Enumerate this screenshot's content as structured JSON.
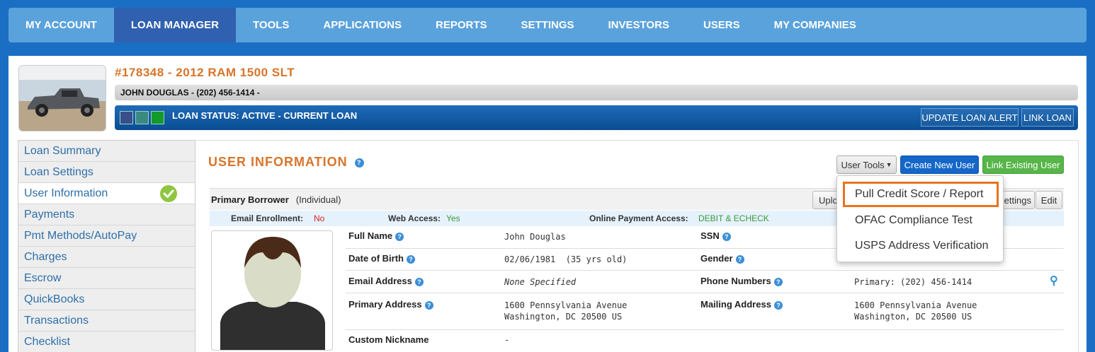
{
  "nav": {
    "items": [
      "MY ACCOUNT",
      "LOAN MANAGER",
      "TOOLS",
      "APPLICATIONS",
      "REPORTS",
      "SETTINGS",
      "INVESTORS",
      "USERS",
      "MY COMPANIES"
    ],
    "active": "LOAN MANAGER"
  },
  "loan": {
    "title": "#178348 - 2012 RAM 1500 SLT",
    "borrower_line": "JOHN DOUGLAS - (202) 456-1414 -",
    "status": "LOAN STATUS: ACTIVE - CURRENT LOAN",
    "update_alert": "UPDATE LOAN ALERT",
    "link_loan": "LINK LOAN"
  },
  "sidebar": {
    "items": [
      {
        "label": "Loan Summary"
      },
      {
        "label": "Loan Settings"
      },
      {
        "label": "User Information"
      },
      {
        "label": "Payments"
      },
      {
        "label": "Pmt Methods/AutoPay"
      },
      {
        "label": "Charges"
      },
      {
        "label": "Escrow"
      },
      {
        "label": "QuickBooks"
      },
      {
        "label": "Transactions"
      },
      {
        "label": "Checklist"
      }
    ]
  },
  "content": {
    "section_title": "USER INFORMATION",
    "user_tools": "User Tools",
    "create_user": "Create New User",
    "link_user": "Link Existing User",
    "borrower_label": "Primary Borrower",
    "borrower_type": "(Individual)",
    "upload_btn": "Uplo",
    "settings_btn": "Settings",
    "edit_btn": "Edit",
    "access": {
      "email_label": "Email Enrollment:",
      "email_value": "No",
      "web_label": "Web Access:",
      "web_value": "Yes",
      "online_label": "Online Payment Access:",
      "online_value": "DEBIT & ECHECK"
    },
    "fields": {
      "full_name_label": "Full Name",
      "full_name": "John Douglas",
      "ssn_label": "SSN",
      "dob_label": "Date of Birth",
      "dob": "02/06/1981  (35 yrs old)",
      "gender_label": "Gender",
      "email_label": "Email Address",
      "email": "None Specified",
      "phone_label": "Phone Numbers",
      "phone": "Primary: (202) 456-1414",
      "address_label": "Primary Address",
      "address_1": "1600 Pennsylvania Avenue",
      "address_2": "Washington, DC 20500 US",
      "mailing_label": "Mailing Address",
      "mailing_1": "1600 Pennsylvania Avenue",
      "mailing_2": "Washington, DC 20500 US",
      "nickname_label": "Custom Nickname",
      "nickname": "-"
    }
  },
  "dropdown": {
    "items": [
      "Pull Credit Score / Report",
      "OFAC Compliance Test",
      "USPS Address Verification"
    ]
  },
  "colors": {
    "accent_orange": "#d9742a",
    "nav_bg": "#5aa2dc",
    "nav_active": "#3060b0",
    "status_bar": "#0a4d91"
  }
}
